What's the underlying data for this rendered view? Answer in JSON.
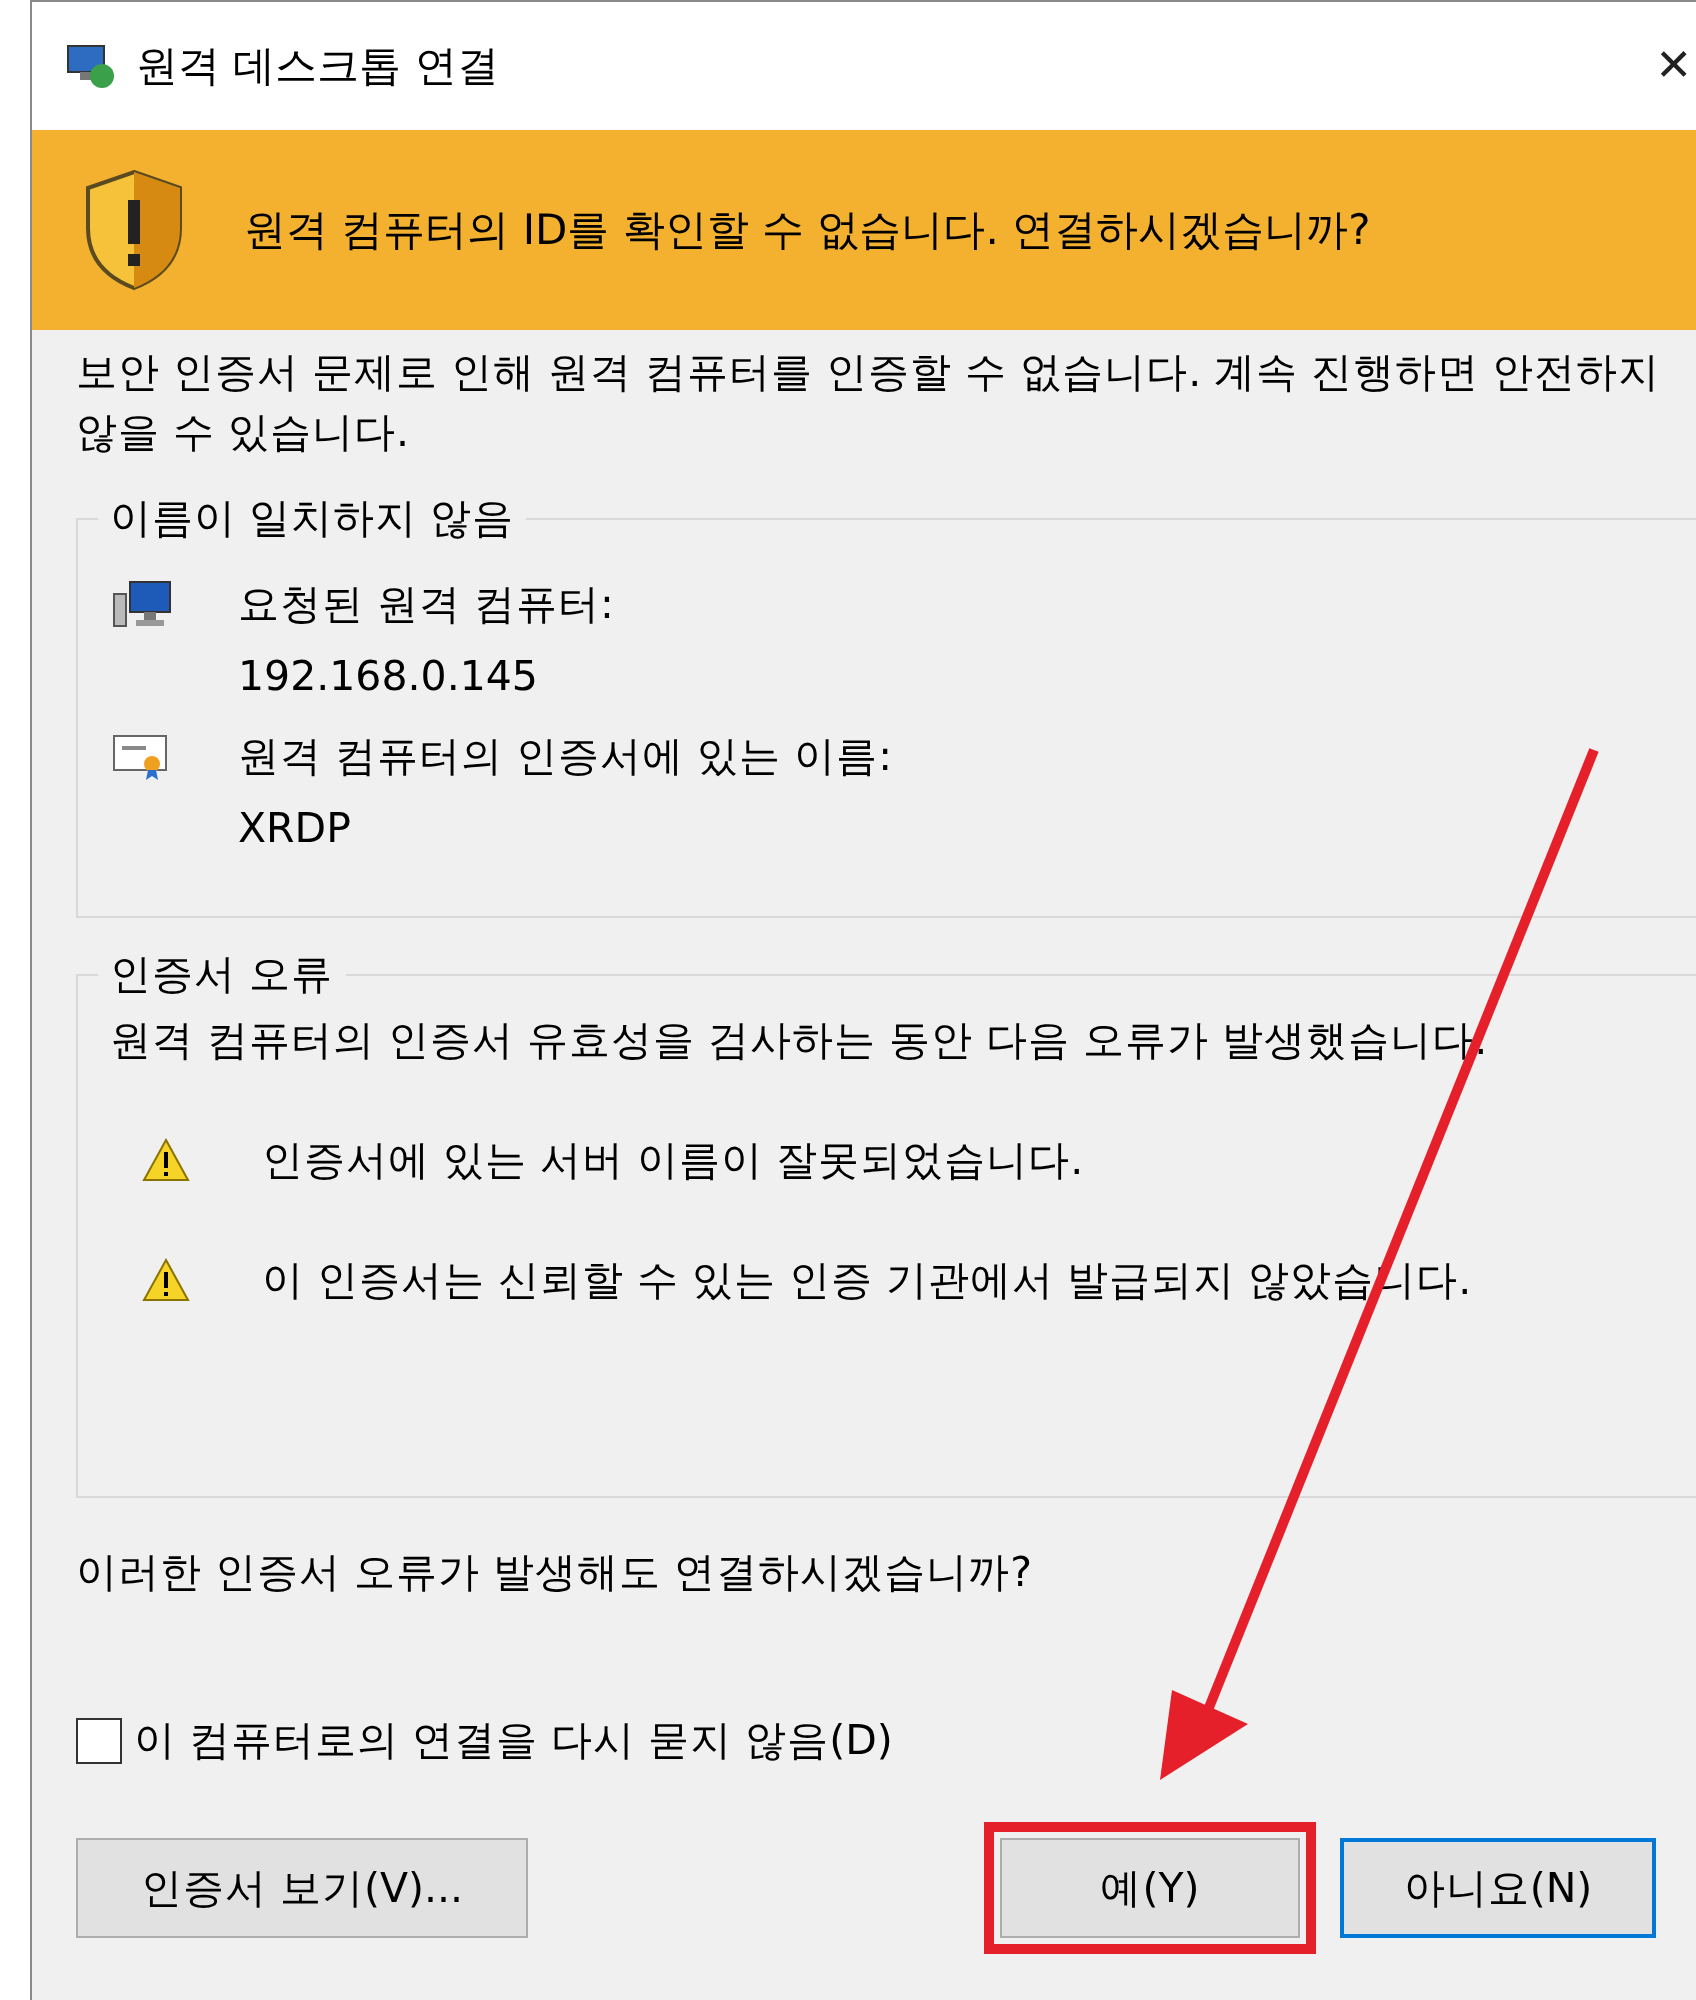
{
  "window": {
    "title": "원격 데스크톱 연결",
    "close": "✕"
  },
  "banner": {
    "text": "원격 컴퓨터의 ID를 확인할 수 없습니다. 연결하시겠습니까?"
  },
  "intro": "보안 인증서 문제로 인해 원격 컴퓨터를 인증할 수 없습니다. 계속 진행하면 안전하지 않을 수 있습니다.",
  "name_group": {
    "title": "이름이 일치하지 않음",
    "items": [
      {
        "kind": "computer",
        "label": "요청된 원격 컴퓨터:",
        "value": "192.168.0.145"
      },
      {
        "kind": "certificate",
        "label": "원격 컴퓨터의 인증서에 있는 이름:",
        "value": "XRDP"
      }
    ]
  },
  "error_group": {
    "title": "인증서 오류",
    "text": "원격 컴퓨터의 인증서 유효성을 검사하는 동안 다음 오류가 발생했습니다.",
    "errors": [
      "인증서에 있는 서버 이름이 잘못되었습니다.",
      "이 인증서는 신뢰할 수 있는 인증 기관에서 발급되지 않았습니다."
    ]
  },
  "question": "이러한 인증서 오류가 발생해도 연결하시겠습니까?",
  "dont_ask": {
    "label": "이 컴퓨터로의 연결을 다시 묻지 않음(D)",
    "checked": false
  },
  "buttons": [
    {
      "label": "인증서 보기(V)...",
      "kind": "plain",
      "highlighted": false
    },
    {
      "label": "예(Y)",
      "kind": "plain",
      "highlighted": true
    },
    {
      "label": "아니요(N)",
      "kind": "default",
      "highlighted": false
    }
  ],
  "annotation_arrow": true
}
